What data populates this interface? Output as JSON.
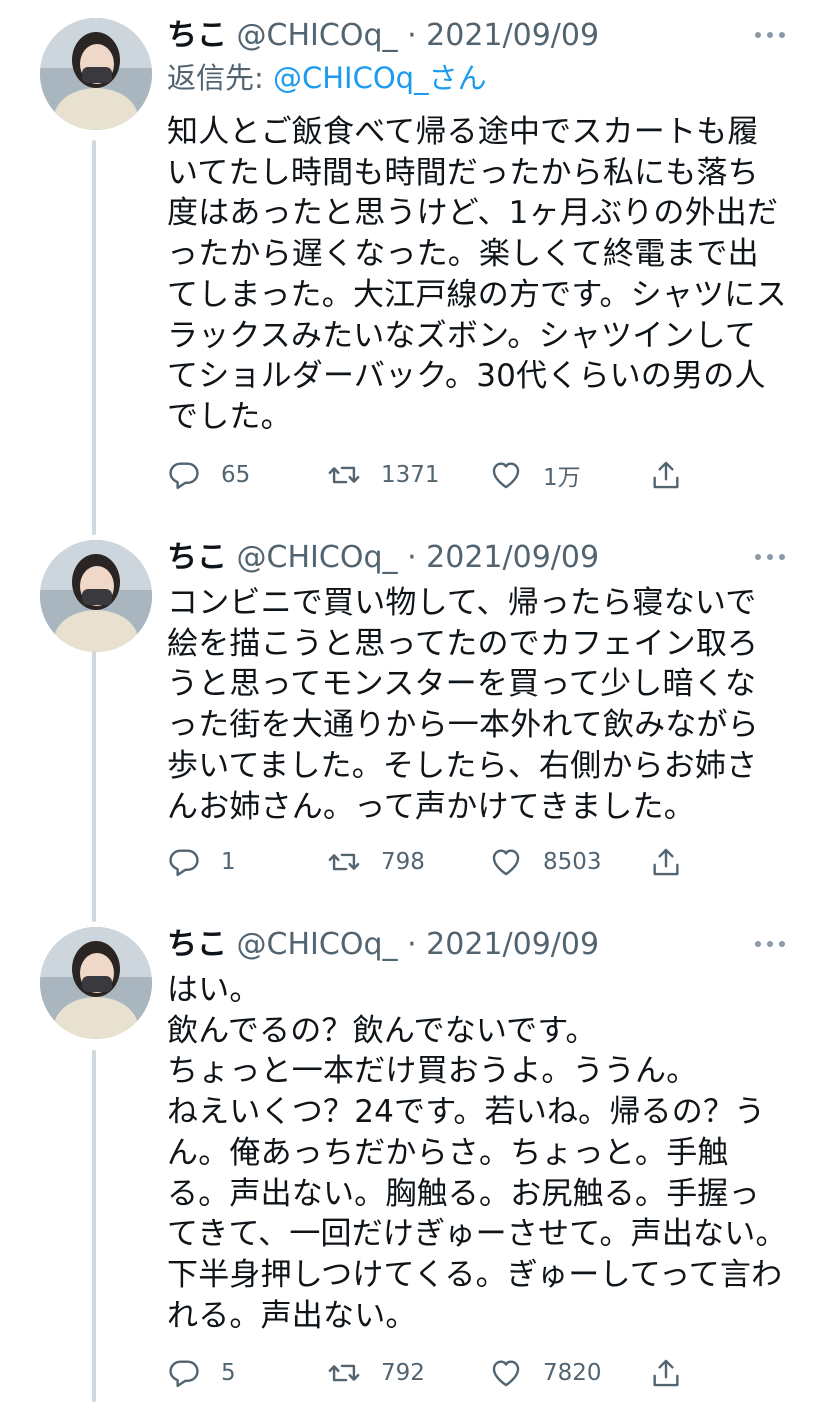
{
  "tweets": [
    {
      "name": "ちこ",
      "handle": "@CHICOq_",
      "separator": "·",
      "date": "2021/09/09",
      "reply_prefix": "返信先: ",
      "reply_mention": "@CHICOq_さん",
      "text": "知人とご飯食べて帰る途中でスカートも履いてたし時間も時間だったから私にも落ち度はあったと思うけど、1ヶ月ぶりの外出だったから遅くなった。楽しくて終電まで出てしまった。大江戸線の方です。シャツにスラックスみたいなズボン。シャツインしててショルダーバック。30代くらいの男の人でした。",
      "replies": "65",
      "retweets": "1371",
      "likes": "1万"
    },
    {
      "name": "ちこ",
      "handle": "@CHICOq_",
      "separator": "·",
      "date": "2021/09/09",
      "text": "コンビニで買い物して、帰ったら寝ないで絵を描こうと思ってたのでカフェイン取ろうと思ってモンスターを買って少し暗くなった街を大通りから一本外れて飲みながら歩いてました。そしたら、右側からお姉さんお姉さん。って声かけてきました。",
      "replies": "1",
      "retweets": "798",
      "likes": "8503"
    },
    {
      "name": "ちこ",
      "handle": "@CHICOq_",
      "separator": "·",
      "date": "2021/09/09",
      "text": "はい。\n飲んでるの？飲んでないです。\nちょっと一本だけ買おうよ。ううん。\nねえいくつ？24です。若いね。帰るの？うん。俺あっちだからさ。ちょっと。手触る。声出ない。胸触る。お尻触る。手握ってきて、一回だけぎゅーさせて。声出ない。下半身押しつけてくる。ぎゅーしてって言われる。声出ない。",
      "replies": "5",
      "retweets": "792",
      "likes": "7820"
    }
  ]
}
